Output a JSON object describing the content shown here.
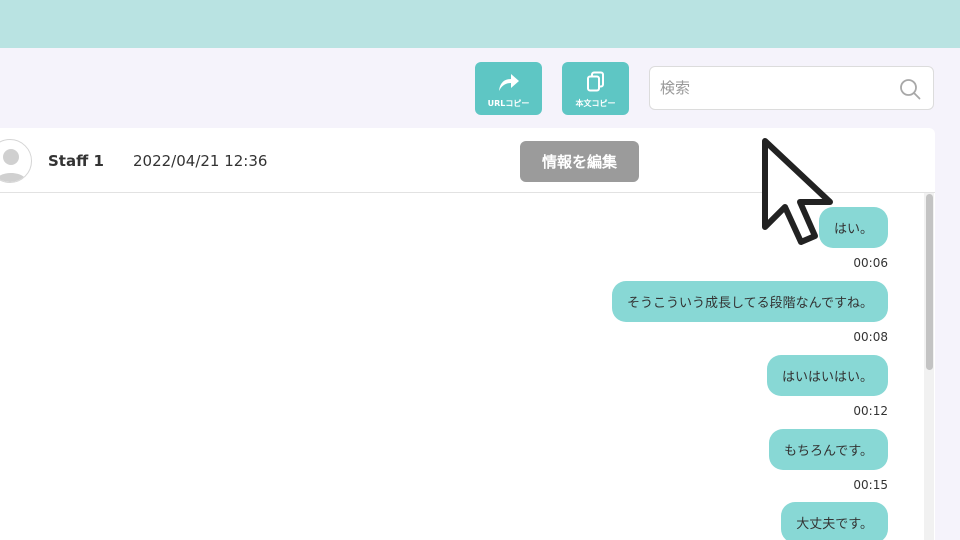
{
  "toolbar": {
    "url_copy_label": "URLコピー",
    "text_copy_label": "本文コピー"
  },
  "search": {
    "placeholder": "検索",
    "value": ""
  },
  "chat": {
    "staff_name": "Staff 1",
    "datetime": "2022/04/21 12:36",
    "edit_label": "情報を編集",
    "messages": [
      {
        "text": "はい。",
        "time": "00:06"
      },
      {
        "text": "そうこういう成長してる段階なんですね。",
        "time": "00:08"
      },
      {
        "text": "はいはいはい。",
        "time": "00:12"
      },
      {
        "text": "もちろんです。",
        "time": "00:15"
      },
      {
        "text": "大丈夫です。",
        "time": ""
      }
    ]
  },
  "colors": {
    "topbar": "#b9e3e2",
    "accent": "#5ec6c4",
    "bubble": "#88d8d5",
    "edit_button": "#9b9b9b"
  },
  "icons": {
    "url_copy": "share-arrow-icon",
    "text_copy": "copy-icon",
    "search": "search-icon",
    "avatar": "user-avatar-icon"
  }
}
